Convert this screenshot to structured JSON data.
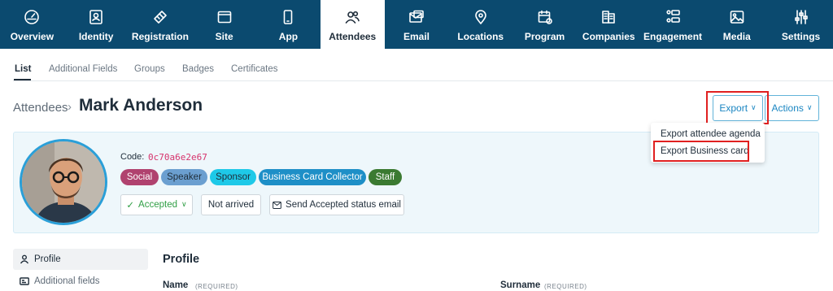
{
  "nav": {
    "items": [
      {
        "label": "Overview",
        "icon": "dashboard-icon"
      },
      {
        "label": "Identity",
        "icon": "identity-card-icon"
      },
      {
        "label": "Registration",
        "icon": "ticket-icon"
      },
      {
        "label": "Site",
        "icon": "browser-window-icon"
      },
      {
        "label": "App",
        "icon": "mobile-phone-icon"
      },
      {
        "label": "Attendees",
        "icon": "people-icon"
      },
      {
        "label": "Email",
        "icon": "email-icon"
      },
      {
        "label": "Locations",
        "icon": "map-pin-icon"
      },
      {
        "label": "Program",
        "icon": "calendar-icon"
      },
      {
        "label": "Companies",
        "icon": "building-icon"
      },
      {
        "label": "Engagement",
        "icon": "engagement-icon"
      },
      {
        "label": "Media",
        "icon": "image-icon"
      },
      {
        "label": "Settings",
        "icon": "sliders-icon"
      }
    ],
    "active": "Attendees"
  },
  "subtabs": [
    "List",
    "Additional Fields",
    "Groups",
    "Badges",
    "Certificates"
  ],
  "breadcrumb": {
    "parent": "Attendees",
    "separator": "›",
    "current": "Mark Anderson"
  },
  "buttons": {
    "export": "Export",
    "actions": "Actions"
  },
  "export_menu": [
    "Export attendee agenda",
    "Export Business card"
  ],
  "attendee": {
    "code_label": "Code:",
    "code": "0c70a6e2e67",
    "tags": [
      {
        "label": "Social",
        "bg": "#b0426f",
        "fg": "#ffffff"
      },
      {
        "label": "Speaker",
        "bg": "#6b9fd0",
        "fg": "#1f2d3a"
      },
      {
        "label": "Sponsor",
        "bg": "#1ec9e8",
        "fg": "#1f2d3a"
      },
      {
        "label": "Business Card Collector",
        "bg": "#1e8fc7",
        "fg": "#ffffff"
      },
      {
        "label": "Staff",
        "bg": "#3b7a31",
        "fg": "#ffffff"
      }
    ],
    "status": "Accepted",
    "arrival": "Not arrived",
    "send_email": "Send Accepted status email"
  },
  "sidebar": [
    {
      "label": "Profile",
      "icon": "user-icon"
    },
    {
      "label": "Additional fields",
      "icon": "id-card-icon"
    }
  ],
  "profile": {
    "title": "Profile",
    "fields": [
      {
        "label": "Name",
        "required": "(REQUIRED)"
      },
      {
        "label": "Surname",
        "required": "(REQUIRED)"
      }
    ]
  },
  "colors": {
    "nav_bg": "#0b4a6f",
    "accent": "#1b86c2",
    "highlight": "#e02020",
    "accepted": "#2f9e44"
  }
}
